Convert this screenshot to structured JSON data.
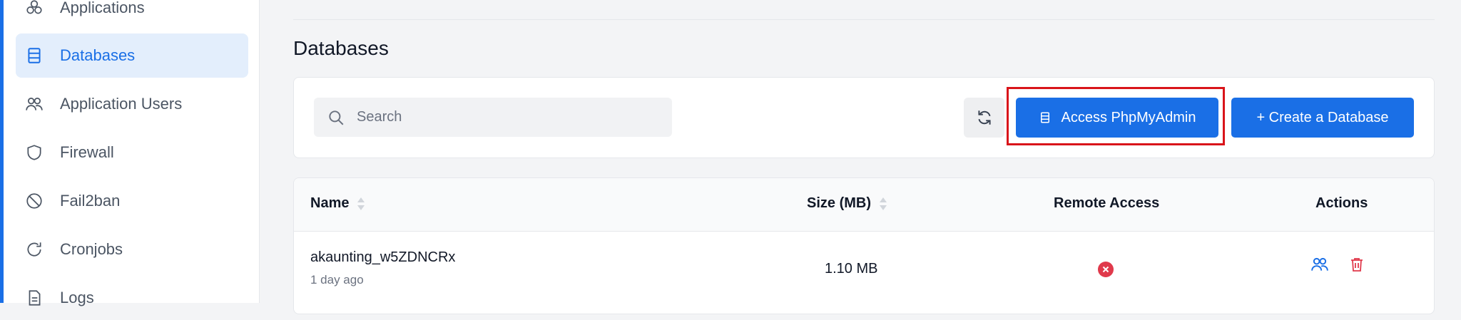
{
  "sidebar": {
    "items": [
      {
        "label": "Applications",
        "icon": "applications-icon"
      },
      {
        "label": "Databases",
        "icon": "database-icon",
        "active": true
      },
      {
        "label": "Application Users",
        "icon": "users-icon"
      },
      {
        "label": "Firewall",
        "icon": "shield-icon"
      },
      {
        "label": "Fail2ban",
        "icon": "ban-icon"
      },
      {
        "label": "Cronjobs",
        "icon": "refresh-icon"
      },
      {
        "label": "Logs",
        "icon": "logs-icon"
      }
    ]
  },
  "main": {
    "title": "Databases",
    "search": {
      "placeholder": "Search"
    },
    "refresh_icon": "refresh-icon",
    "buttons": {
      "phpmyadmin": "Access PhpMyAdmin",
      "create": "+ Create a Database"
    }
  },
  "table": {
    "headers": {
      "name": "Name",
      "size": "Size (MB)",
      "remote": "Remote Access",
      "actions": "Actions"
    },
    "rows": [
      {
        "name": "akaunting_w5ZDNCRx",
        "created": "1 day ago",
        "size": "1.10 MB",
        "remote_access": false
      }
    ]
  },
  "colors": {
    "accent": "#1a6fe6",
    "active_bg": "#e3eefc",
    "highlight": "#d9141a",
    "danger": "#e0394b"
  }
}
